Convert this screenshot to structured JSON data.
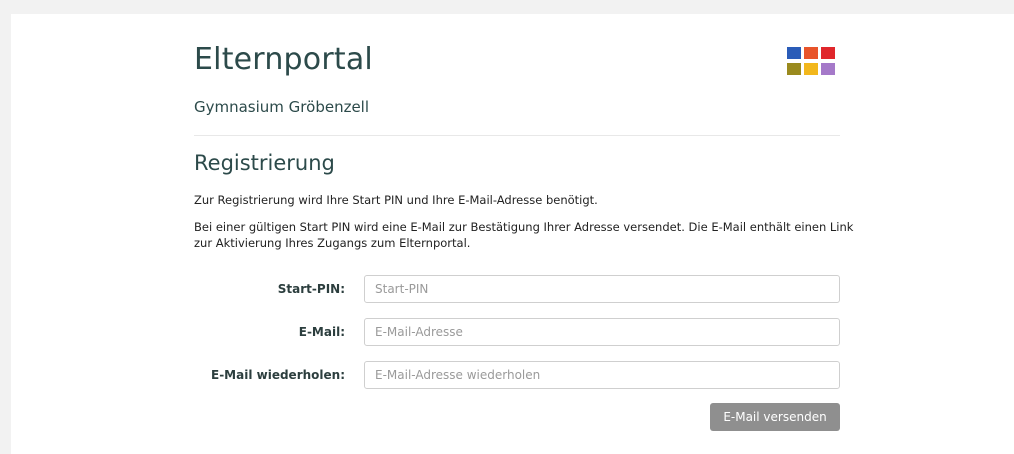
{
  "header": {
    "title": "Elternportal",
    "school": "Gymnasium Gröbenzell"
  },
  "logo": {
    "colors": [
      "#2a5cb8",
      "#e8542a",
      "#e0262b",
      "#9a8a1e",
      "#f2b71c",
      "#a579c9"
    ]
  },
  "registration": {
    "heading": "Registrierung",
    "intro": "Zur Registrierung wird Ihre Start PIN und Ihre E-Mail-Adresse benötigt.",
    "details": "Bei einer gültigen Start PIN wird eine E-Mail zur Bestätigung Ihrer Adresse versendet. Die E-Mail enthält einen Link zur Aktivierung Ihres Zugangs zum Elternportal."
  },
  "form": {
    "pin_label": "Start-PIN:",
    "pin_placeholder": "Start-PIN",
    "email_label": "E-Mail:",
    "email_placeholder": "E-Mail-Adresse",
    "email_repeat_label": "E-Mail wiederholen:",
    "email_repeat_placeholder": "E-Mail-Adresse wiederholen",
    "submit_label": "E-Mail versenden"
  }
}
